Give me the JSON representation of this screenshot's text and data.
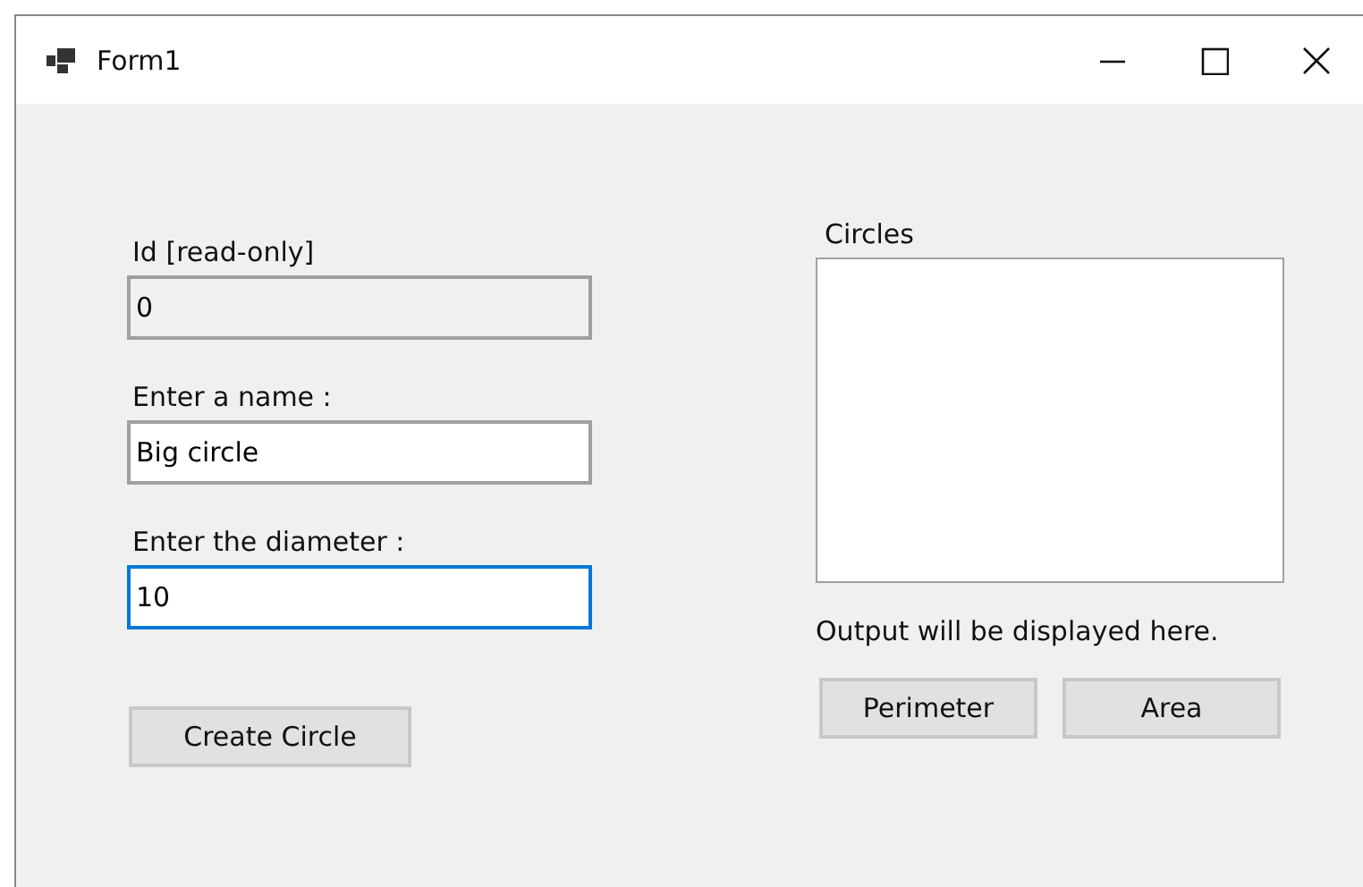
{
  "window": {
    "title": "Form1"
  },
  "fields": [
    {
      "label": "Id [read-only]",
      "value": "0",
      "read_only": true,
      "focused": false
    },
    {
      "label": "Enter a name :",
      "value": "Big circle",
      "read_only": false,
      "focused": false
    },
    {
      "label": "Enter the diameter :",
      "value": "10",
      "read_only": false,
      "focused": true
    }
  ],
  "create_button": "Create Circle",
  "list": {
    "label": "Circles"
  },
  "output": "Output will be displayed here.",
  "buttons": [
    "Perimeter",
    "Area"
  ]
}
